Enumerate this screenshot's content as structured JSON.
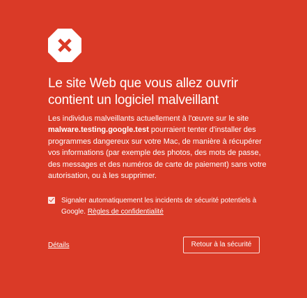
{
  "warning": {
    "icon": "stop-x-icon",
    "title": "Le site Web que vous allez ouvrir contient un logiciel malveillant",
    "body_before": "Les individus malveillants actuellement à l'œuvre sur le site ",
    "body_site": "malware.testing.google.test",
    "body_after": " pourraient tenter d'installer des programmes dangereux sur votre Mac, de manière à récupérer vos informations (par exemple des photos, des mots de passe, des messages et des numéros de carte de paiement) sans votre autorisation, ou à les supprimer.",
    "checkbox": {
      "checked": true,
      "label": "Signaler automatiquement les incidents de sécurité potentiels à Google.",
      "link": "Règles de confidentialité"
    },
    "details_link": "Détails",
    "back_button": "Retour à la sécurité"
  },
  "colors": {
    "background": "#da3a27",
    "text": "#ffffff"
  }
}
